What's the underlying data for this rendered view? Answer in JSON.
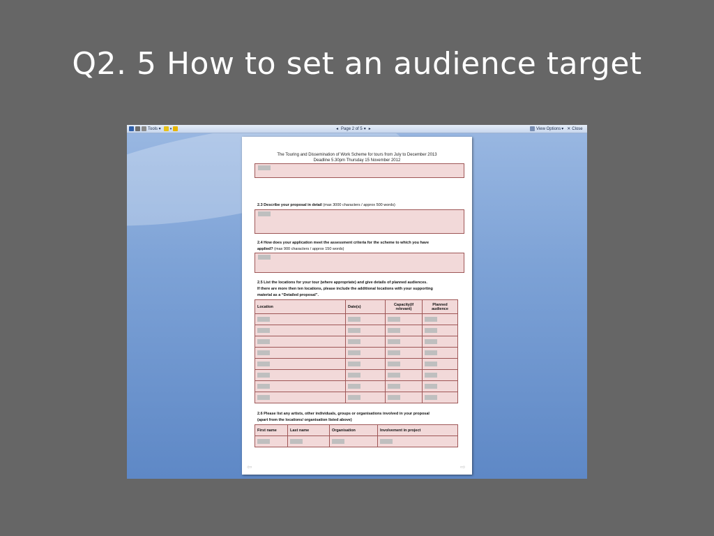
{
  "slide": {
    "title": "Q2. 5 How to set an audience target"
  },
  "toolbar": {
    "tools_label": "Tools",
    "page_label": "Page 2 of 5",
    "view_options_label": "View Options",
    "close_label": "Close"
  },
  "document": {
    "header_line1": "The Touring and Dissemination  of Work Scheme for tours from July to December 2013",
    "header_line2": "Deadline 5.30pm Thursday 15 November 2012",
    "q23_bold": "2.3 Describe your proposal in detail",
    "q23_rest": " (max 3000 characters / approx 500 words)",
    "q24_bold_line1": "2.4 How does your application  meet the assessment criteria for the scheme to which you have",
    "q24_bold_line2": "applied?",
    "q24_rest": "  (max 900 characters / approx 150 words)",
    "q25_line1": "2.5 List the locations for your tour (where appropriate) and give details of planned audiences.",
    "q25_line2": "If there are more then ten locations, please include the additional locations with your supporting",
    "q25_line3": "material as a “Detailed proposal”.",
    "locations_table": {
      "headers": [
        "Location",
        "Date(s)",
        "Capacity(if relevant)",
        "Planned audience"
      ],
      "row_count": 8
    },
    "q26_line1": "2.6 Please list any artists, other individuals, groups or organisations  involved in your proposal",
    "q26_line2": "(apart from the locations/  organisation listed above)",
    "people_table": {
      "headers": [
        "First name",
        "Last name",
        "Organisation",
        "Involvement in project"
      ]
    }
  },
  "icons": [
    "save-icon",
    "print-icon",
    "tools-icon",
    "highlight-icon",
    "folder-icon",
    "prev-page-icon",
    "next-page-icon",
    "view-options-icon",
    "close-icon",
    "prev-screen-icon",
    "next-screen-icon"
  ]
}
